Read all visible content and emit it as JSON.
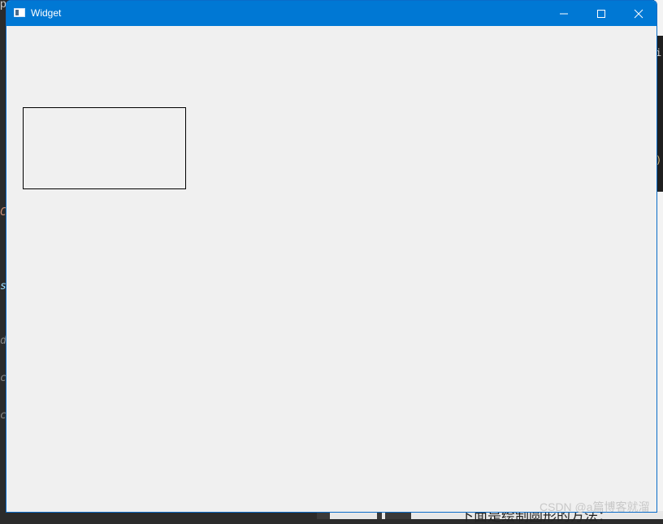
{
  "window": {
    "title": "Widget",
    "app_icon": "app-window-icon",
    "controls": {
      "minimize_icon": "minimize-icon",
      "maximize_icon": "maximize-icon",
      "close_icon": "close-icon"
    }
  },
  "colors": {
    "titlebar": "#0078d4",
    "client_background": "#f0f0f0",
    "rectangle_stroke": "#000000"
  },
  "background": {
    "bottom_text": "下面是绘制圆形的方法：",
    "watermark": "CSDN @a篇博客就溜"
  }
}
